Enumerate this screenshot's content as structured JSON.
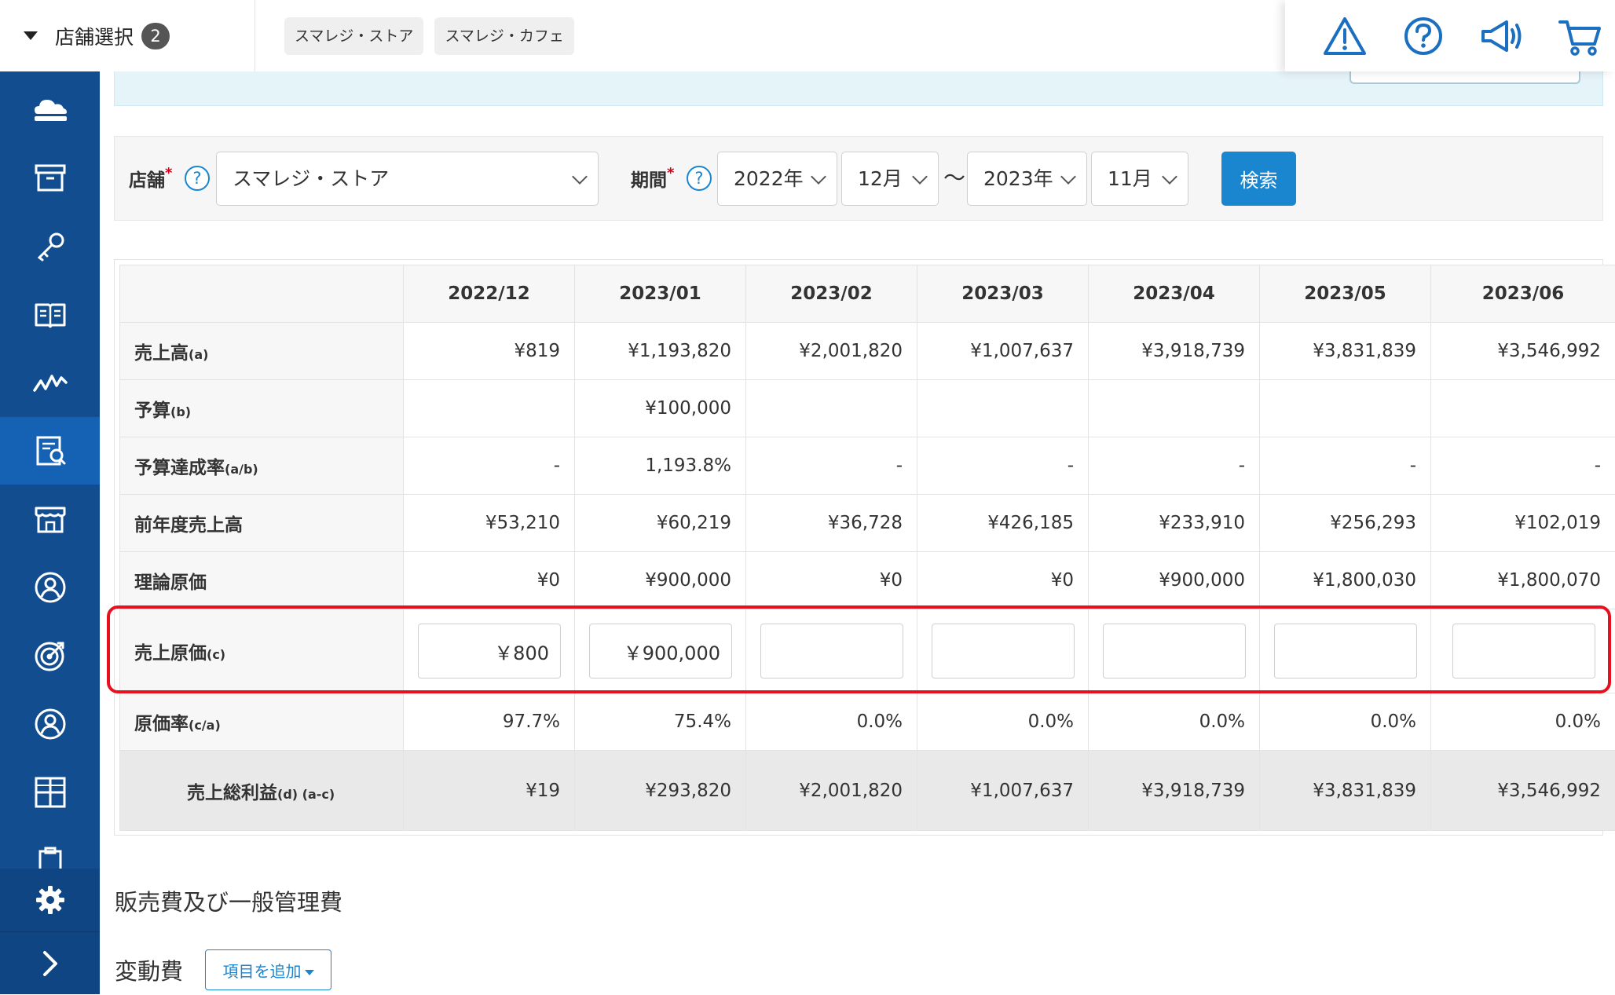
{
  "header": {
    "store_select_label": "店舗選択",
    "store_count": "2",
    "store_chips": [
      "スマレジ・ストア",
      "スマレジ・カフェ"
    ],
    "icons": [
      "warning-icon",
      "help-icon",
      "megaphone-icon",
      "cart-icon"
    ]
  },
  "sidebar": {
    "items": [
      "cloud-register-icon",
      "archive-box-icon",
      "key-icon",
      "book-icon",
      "chart-line-icon",
      "report-icon",
      "store-icon",
      "customer-icon",
      "target-icon",
      "user-icon",
      "apps-grid-icon",
      "clipboard-icon"
    ],
    "active_index": 5,
    "bottom": [
      "gear-icon",
      "chevron-right-icon"
    ]
  },
  "filter": {
    "store_label": "店舗",
    "store_value": "スマレジ・ストア",
    "period_label": "期間",
    "required_mark": "*",
    "help_glyph": "?",
    "from_year": "2022年",
    "from_month": "12月",
    "range_sep": "〜",
    "to_year": "2023年",
    "to_month": "11月",
    "search_label": "検索"
  },
  "table": {
    "columns": [
      "2022/12",
      "2023/01",
      "2023/02",
      "2023/03",
      "2023/04",
      "2023/05",
      "2023/06"
    ],
    "rows": [
      {
        "label": "売上高",
        "sub": "(a)",
        "values": [
          "¥819",
          "¥1,193,820",
          "¥2,001,820",
          "¥1,007,637",
          "¥3,918,739",
          "¥3,831,839",
          "¥3,546,992"
        ]
      },
      {
        "label": "予算",
        "sub": "(b)",
        "values": [
          "",
          "¥100,000",
          "",
          "",
          "",
          "",
          ""
        ]
      },
      {
        "label": "予算達成率",
        "sub": "(a/b)",
        "values": [
          "-",
          "1,193.8%",
          "-",
          "-",
          "-",
          "-",
          "-"
        ]
      },
      {
        "label": "前年度売上高",
        "sub": "",
        "values": [
          "¥53,210",
          "¥60,219",
          "¥36,728",
          "¥426,185",
          "¥233,910",
          "¥256,293",
          "¥102,019"
        ]
      },
      {
        "label": "理論原価",
        "sub": "",
        "values": [
          "¥0",
          "¥900,000",
          "¥0",
          "¥0",
          "¥900,000",
          "¥1,800,030",
          "¥1,800,070"
        ]
      }
    ],
    "cost_row": {
      "label": "売上原価",
      "sub": "(c)",
      "inputs": [
        "￥800",
        "￥900,000",
        "",
        "",
        "",
        "",
        ""
      ]
    },
    "rate_row": {
      "label": "原価率",
      "sub": "(c/a)",
      "values": [
        "97.7%",
        "75.4%",
        "0.0%",
        "0.0%",
        "0.0%",
        "0.0%",
        "0.0%"
      ]
    },
    "total_row": {
      "label": "売上総利益",
      "sub": "(d) (a-c)",
      "values": [
        "¥19",
        "¥293,820",
        "¥2,001,820",
        "¥1,007,637",
        "¥3,918,739",
        "¥3,831,839",
        "¥3,546,992"
      ]
    }
  },
  "sections": {
    "sga_title": "販売費及び一般管理費",
    "variable_title": "変動費",
    "add_item_label": "項目を追加"
  },
  "colors": {
    "nav": "#124d8f",
    "nav_active": "#1561b3",
    "primary": "#1a86d0",
    "highlight": "#e8101e"
  }
}
